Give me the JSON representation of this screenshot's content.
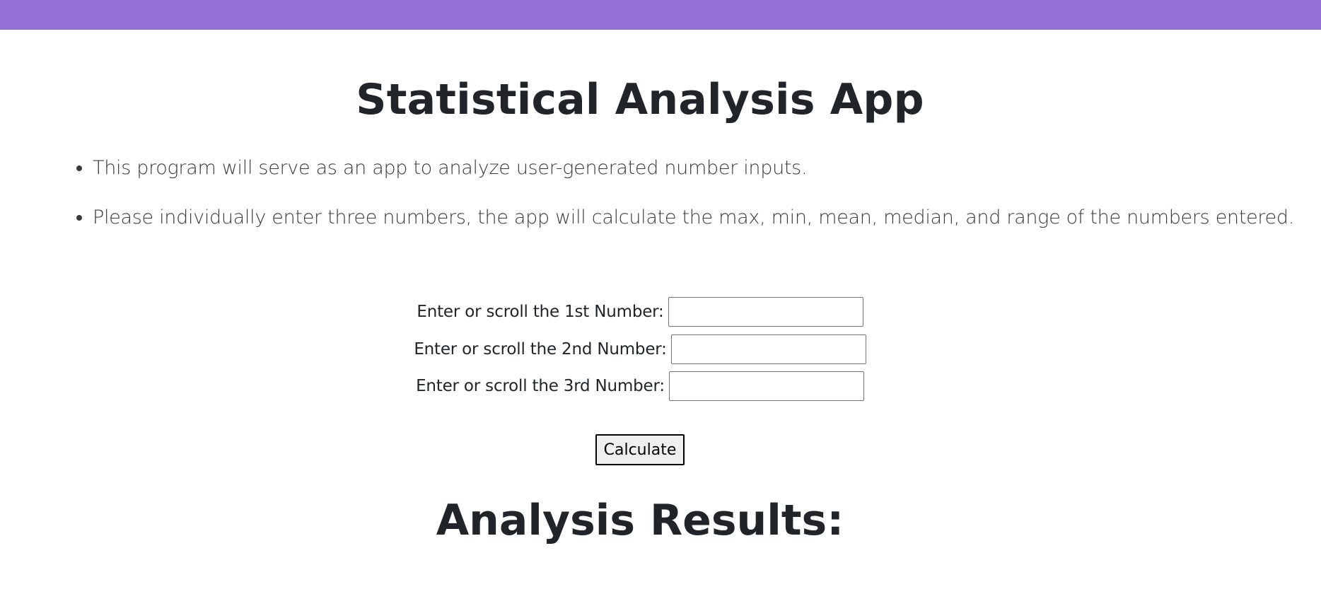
{
  "header": {
    "bar_color": "#9370d8"
  },
  "page": {
    "title": "Statistical Analysis App",
    "intro": [
      "This program will serve as an app to analyze user-generated number inputs.",
      "Please individually enter three numbers, the app will calculate the max, min, mean, median, and range of the numbers entered."
    ]
  },
  "form": {
    "fields": [
      {
        "label": "Enter or scroll the 1st Number:",
        "value": ""
      },
      {
        "label": "Enter or scroll the 2nd Number:",
        "value": ""
      },
      {
        "label": "Enter or scroll the 3rd Number:",
        "value": ""
      }
    ],
    "calculate_label": "Calculate"
  },
  "results": {
    "title": "Analysis Results:"
  }
}
